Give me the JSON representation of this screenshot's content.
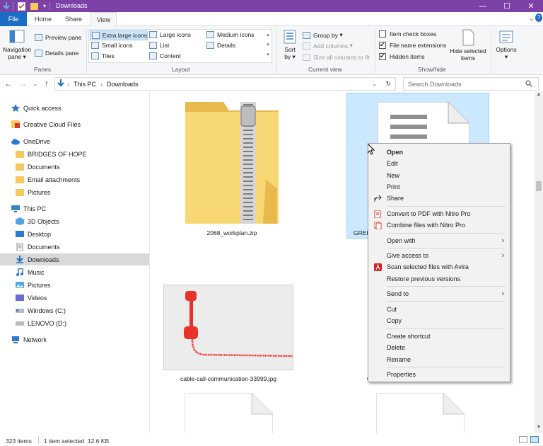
{
  "window": {
    "title": "Downloads",
    "accent_color": "#7c41a6"
  },
  "tabs": {
    "file": "File",
    "home": "Home",
    "share": "Share",
    "view": "View",
    "active": "View"
  },
  "ribbon": {
    "panes": {
      "label": "Panes",
      "navigation_pane": "Navigation",
      "navigation_pane_2": "pane",
      "preview_pane": "Preview pane",
      "details_pane": "Details pane"
    },
    "layout": {
      "label": "Layout",
      "extra_large_icons": "Extra large icons",
      "large_icons": "Large icons",
      "medium_icons": "Medium icons",
      "small_icons": "Small icons",
      "list": "List",
      "details": "Details",
      "tiles": "Tiles",
      "content": "Content",
      "selected": "Extra large icons"
    },
    "current_view": {
      "label": "Current view",
      "sort_by": "Sort",
      "sort_by_2": "by",
      "group_by": "Group by",
      "add_columns": "Add columns",
      "size_all_columns": "Size all columns to fit"
    },
    "show_hide": {
      "label": "Show/hide",
      "item_check_boxes": "Item check boxes",
      "item_check_boxes_checked": false,
      "file_name_extensions": "File name extensions",
      "file_name_extensions_checked": true,
      "hidden_items": "Hidden items",
      "hidden_items_checked": true,
      "hide_selected_items": "Hide selected",
      "hide_selected_items_2": "items"
    },
    "options": "Options"
  },
  "address_bar": {
    "path": [
      "This PC",
      "Downloads"
    ],
    "search_placeholder": "Search Downloads"
  },
  "sidebar": {
    "items": [
      {
        "label": "Quick access",
        "icon": "star-icon"
      },
      {
        "label": "Creative Cloud Files",
        "icon": "creative-cloud-icon"
      },
      {
        "label": "OneDrive",
        "icon": "cloud-icon"
      },
      {
        "label": "BRIDGES OF HOPE",
        "icon": "folder-icon"
      },
      {
        "label": "Documents",
        "icon": "folder-icon"
      },
      {
        "label": "Email attachments",
        "icon": "folder-icon"
      },
      {
        "label": "Pictures",
        "icon": "folder-icon"
      },
      {
        "label": "This PC",
        "icon": "computer-icon"
      },
      {
        "label": "3D Objects",
        "icon": "cube-icon"
      },
      {
        "label": "Desktop",
        "icon": "desktop-icon"
      },
      {
        "label": "Documents",
        "icon": "document-icon"
      },
      {
        "label": "Downloads",
        "icon": "download-icon"
      },
      {
        "label": "Music",
        "icon": "music-icon"
      },
      {
        "label": "Pictures",
        "icon": "picture-icon"
      },
      {
        "label": "Videos",
        "icon": "video-icon"
      },
      {
        "label": "Windows (C:)",
        "icon": "drive-icon"
      },
      {
        "label": "LENOVO (D:)",
        "icon": "drive-icon"
      },
      {
        "label": "Network",
        "icon": "network-icon"
      }
    ],
    "selected": "Downloads"
  },
  "files": [
    {
      "name": "2068_workplan.zip",
      "type": "zip-folder"
    },
    {
      "name": "GREE",
      "type": "document"
    },
    {
      "name": "cable-call-communication-33999.jpg",
      "type": "image"
    },
    {
      "name": "C",
      "type": "image"
    }
  ],
  "context_menu": {
    "items": [
      {
        "label": "Open",
        "bold": true
      },
      {
        "label": "Edit"
      },
      {
        "label": "New"
      },
      {
        "label": "Print"
      },
      {
        "label": "Share",
        "icon": "share-icon"
      },
      {
        "label": "Convert to PDF with Nitro Pro",
        "icon": "nitro-icon"
      },
      {
        "label": "Combine files with Nitro Pro",
        "icon": "nitro-combine-icon"
      },
      {
        "label": "Open with",
        "submenu": true
      },
      {
        "label": "Give access to",
        "submenu": true
      },
      {
        "label": "Scan selected files with Avira",
        "icon": "avira-icon"
      },
      {
        "label": "Restore previous versions"
      },
      {
        "label": "Send to",
        "submenu": true
      },
      {
        "label": "Cut"
      },
      {
        "label": "Copy"
      },
      {
        "label": "Create shortcut"
      },
      {
        "label": "Delete"
      },
      {
        "label": "Rename"
      },
      {
        "label": "Properties"
      }
    ]
  },
  "status": {
    "item_count": "323 items",
    "selection": "1 item selected  12.6 KB"
  }
}
